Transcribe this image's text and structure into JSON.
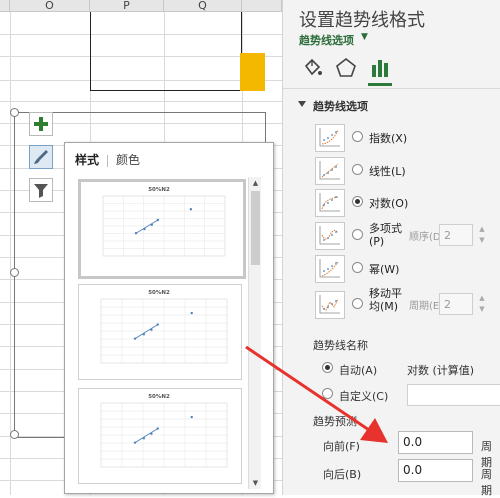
{
  "sheet": {
    "columns": [
      "O",
      "P",
      "Q"
    ]
  },
  "popup": {
    "tabs": [
      "样式",
      "颜色"
    ],
    "thumb_title": "50%N2"
  },
  "pane": {
    "title": "设置趋势线格式",
    "subtitle": "趋势线选项",
    "section": "趋势线选项",
    "options": [
      {
        "label": "指数(X)",
        "selected": false
      },
      {
        "label": "线性(L)",
        "selected": false
      },
      {
        "label": "对数(O)",
        "selected": true
      },
      {
        "label": "多项式(P)",
        "selected": false,
        "sub_label": "顺序(D)",
        "value": "2"
      },
      {
        "label": "幂(W)",
        "selected": false
      },
      {
        "label": "移动平均(M)",
        "selected": false,
        "sub_label": "周期(E)",
        "value": "2"
      }
    ],
    "name_section": "趋势线名称",
    "name_auto": "自动(A)",
    "name_auto_value": "对数 (计算值)",
    "name_custom": "自定义(C)",
    "forecast_section": "趋势预测",
    "forward_label": "向前(F)",
    "forward_value": "0.0",
    "forward_unit": "周期",
    "backward_label": "向后(B)",
    "backward_value": "0.0",
    "backward_unit": "周期"
  },
  "colors": {
    "accent": "#2b7a3b",
    "highlight_cell": "#f5b800",
    "arrow": "#e8322e"
  }
}
